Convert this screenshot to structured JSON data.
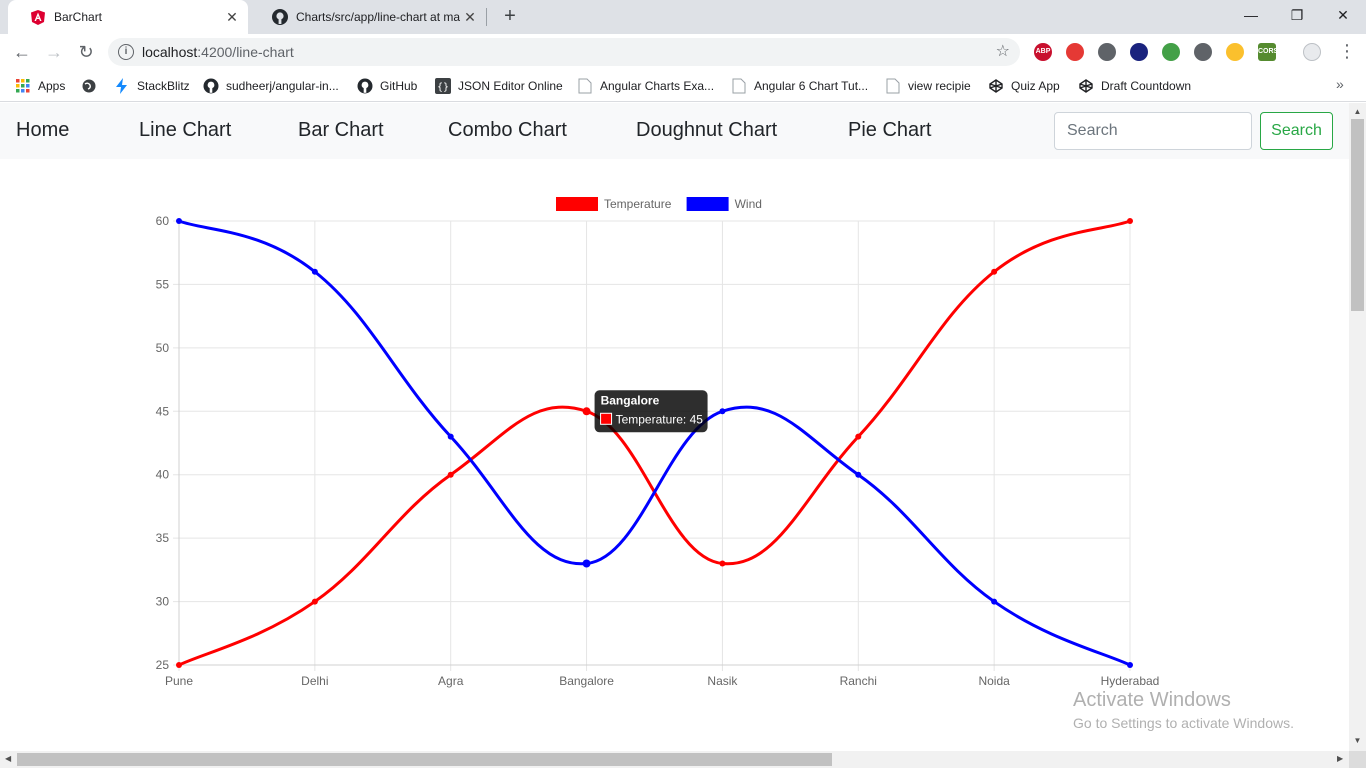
{
  "browser": {
    "tabs": [
      {
        "title": "BarChart",
        "icon": "angular-icon"
      },
      {
        "title": "Charts/src/app/line-chart at mast",
        "icon": "github-icon"
      }
    ],
    "url_host": "localhost",
    "url_path": ":4200/line-chart",
    "bookmarks": [
      {
        "label": "Apps",
        "icon": "apps-grid-icon"
      },
      {
        "label": "",
        "icon": "globe-icon"
      },
      {
        "label": "StackBlitz",
        "icon": "stackblitz-icon"
      },
      {
        "label": "sudheerj/angular-in...",
        "icon": "github-icon"
      },
      {
        "label": "GitHub",
        "icon": "github-icon"
      },
      {
        "label": "JSON Editor Online",
        "icon": "json-icon"
      },
      {
        "label": "Angular Charts Exa...",
        "icon": "page-icon"
      },
      {
        "label": "Angular 6 Chart Tut...",
        "icon": "page-icon"
      },
      {
        "label": "view recipie",
        "icon": "page-icon"
      },
      {
        "label": "Quiz App",
        "icon": "codepen-icon"
      },
      {
        "label": "Draft Countdown",
        "icon": "codepen-icon"
      }
    ],
    "extensions": [
      {
        "text": "ABP",
        "color": "#c8102e"
      },
      {
        "text": "",
        "color": "#e53935"
      },
      {
        "text": "",
        "color": "#5f6368"
      },
      {
        "text": "",
        "color": "#1a237e"
      },
      {
        "text": "",
        "color": "#43a047"
      },
      {
        "text": "",
        "color": "#5f6368"
      },
      {
        "text": "",
        "color": "#fbc02d"
      },
      {
        "text": "CORS",
        "color": "#558b2f"
      }
    ]
  },
  "nav": {
    "links": [
      "Home",
      "Line Chart",
      "Bar Chart",
      "Combo Chart",
      "Doughnut Chart",
      "Pie Chart"
    ],
    "search_placeholder": "Search",
    "search_button": "Search"
  },
  "chart_data": {
    "type": "line",
    "categories": [
      "Pune",
      "Delhi",
      "Agra",
      "Bangalore",
      "Nasik",
      "Ranchi",
      "Noida",
      "Hyderabad"
    ],
    "series": [
      {
        "name": "Temperature",
        "color": "#ff0000",
        "values": [
          25,
          30,
          40,
          45,
          33,
          43,
          56,
          60
        ]
      },
      {
        "name": "Wind",
        "color": "#0000ff",
        "values": [
          60,
          56,
          43,
          33,
          45,
          40,
          30,
          25
        ]
      }
    ],
    "ylim": [
      25,
      60
    ],
    "yticks": [
      25,
      30,
      35,
      40,
      45,
      50,
      55,
      60
    ],
    "grid": true,
    "legend": "top",
    "tooltip": {
      "title": "Bangalore",
      "label": "Temperature: 45",
      "series": 0,
      "index": 3
    }
  },
  "watermark": {
    "line1": "Activate Windows",
    "line2": "Go to Settings to activate Windows."
  }
}
